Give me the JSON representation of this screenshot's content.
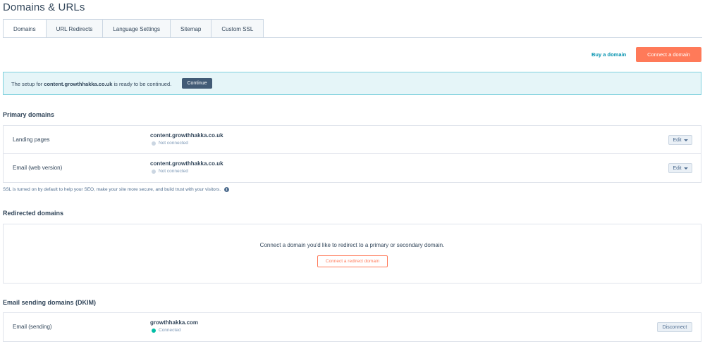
{
  "page": {
    "title": "Domains & URLs"
  },
  "tabs": [
    {
      "label": "Domains"
    },
    {
      "label": "URL Redirects"
    },
    {
      "label": "Language Settings"
    },
    {
      "label": "Sitemap"
    },
    {
      "label": "Custom SSL"
    }
  ],
  "actions": {
    "buy_domain": "Buy a domain",
    "connect_domain": "Connect a domain"
  },
  "alert": {
    "text_before": "The setup for ",
    "domain": "content.growthhakka.co.uk",
    "text_after": " is ready to be continued.",
    "button": "Continue"
  },
  "primary": {
    "heading": "Primary domains",
    "rows": [
      {
        "label": "Landing pages",
        "domain": "content.growthhakka.co.uk",
        "status": "Not connected",
        "button": "Edit"
      },
      {
        "label": "Email (web version)",
        "domain": "content.growthhakka.co.uk",
        "status": "Not connected",
        "button": "Edit"
      }
    ],
    "ssl_note": "SSL is turned on by default to help your SEO, make your site more secure, and build trust with your visitors."
  },
  "redirected": {
    "heading": "Redirected domains",
    "empty_text": "Connect a domain you'd like to redirect to a primary or secondary domain.",
    "button": "Connect a redirect domain"
  },
  "email_sending": {
    "heading": "Email sending domains (DKIM)",
    "rows": [
      {
        "label": "Email (sending)",
        "domain": "growthhakka.com",
        "status": "Connected",
        "button": "Disconnect"
      }
    ]
  },
  "colors": {
    "accent": "#ff7a59",
    "link": "#0091ae",
    "connected": "#00bda5",
    "not_connected": "#cbd6e2"
  }
}
